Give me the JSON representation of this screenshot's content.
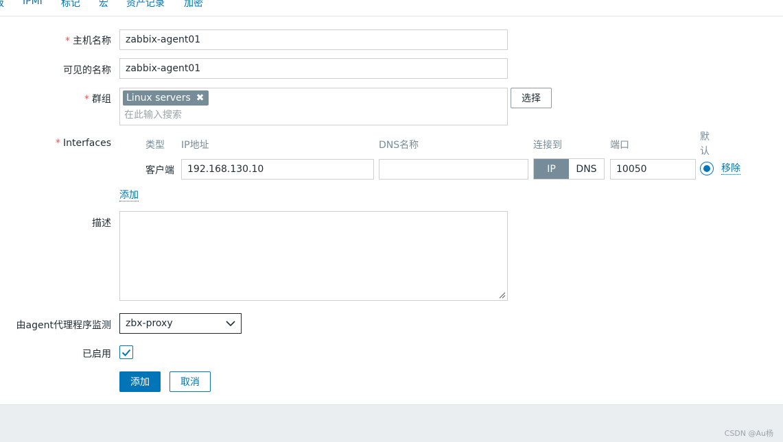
{
  "tabs": [
    "板",
    "IPMI",
    "标记",
    "宏",
    "资产记录",
    "加密"
  ],
  "form": {
    "host_name_label": "主机名称",
    "host_name_value": "zabbix-agent01",
    "visible_name_label": "可见的名称",
    "visible_name_value": "zabbix-agent01",
    "groups_label": "群组",
    "group_chip": "Linux servers",
    "group_search_placeholder": "在此输入搜索",
    "select_button": "选择",
    "required_mark": "*",
    "interfaces": {
      "label": "Interfaces",
      "col_type": "类型",
      "col_ip": "IP地址",
      "col_dns": "DNS名称",
      "col_connect": "连接到",
      "col_port": "端口",
      "col_default": "默认",
      "row_type": "客户端",
      "row_ip": "192.168.130.10",
      "row_dns": "",
      "connect_ip": "IP",
      "connect_dns": "DNS",
      "row_port": "10050",
      "remove_link": "移除",
      "add_link": "添加"
    },
    "description_label": "描述",
    "description_value": "",
    "proxy_label": "由agent代理程序监测",
    "proxy_value": "zbx-proxy",
    "enabled_label": "已启用",
    "enabled": true,
    "add_button": "添加",
    "cancel_button": "取消"
  },
  "footer": {
    "watermark": "CSDN @Au杨"
  },
  "colors": {
    "accent": "#0275b8",
    "chip": "#768d99",
    "required": "#e45959",
    "footer_bg": "#ebeef0"
  }
}
